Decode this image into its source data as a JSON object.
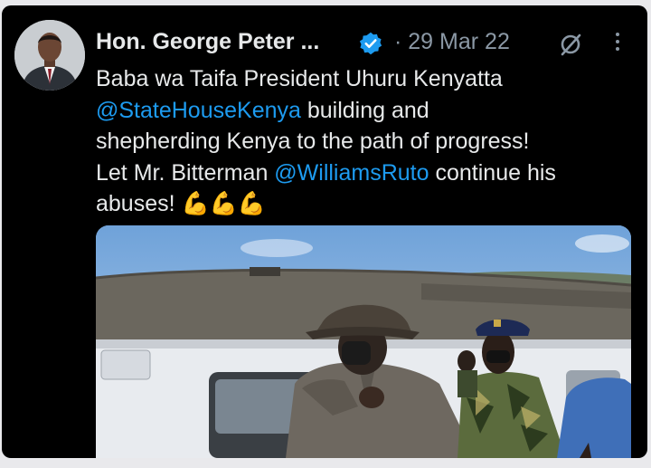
{
  "author": {
    "name": "Hon. George Peter ...",
    "date_separator": "·",
    "date": "29 Mar 22"
  },
  "icons": {
    "verified": "verified-badge-icon",
    "grok": "grok-icon",
    "more": "more-options-icon"
  },
  "tweet": {
    "line1": "Baba wa Taifa President Uhuru Kenyatta",
    "mention1": "@StateHouseKenya",
    "line2_rest": " building and",
    "line3": "shepherding Kenya to the path of progress!",
    "line4_start": "Let Mr. Bitterman ",
    "mention2": "@WilliamsRuto",
    "line4_rest": " continue his",
    "line5": "abuses!",
    "emoji": "💪💪💪"
  },
  "colors": {
    "background": "#000000",
    "text": "#e7e9ea",
    "muted": "#8b98a5",
    "link": "#1d9bf0",
    "verified": "#1d9bf0",
    "emoji": "#f4b400"
  }
}
